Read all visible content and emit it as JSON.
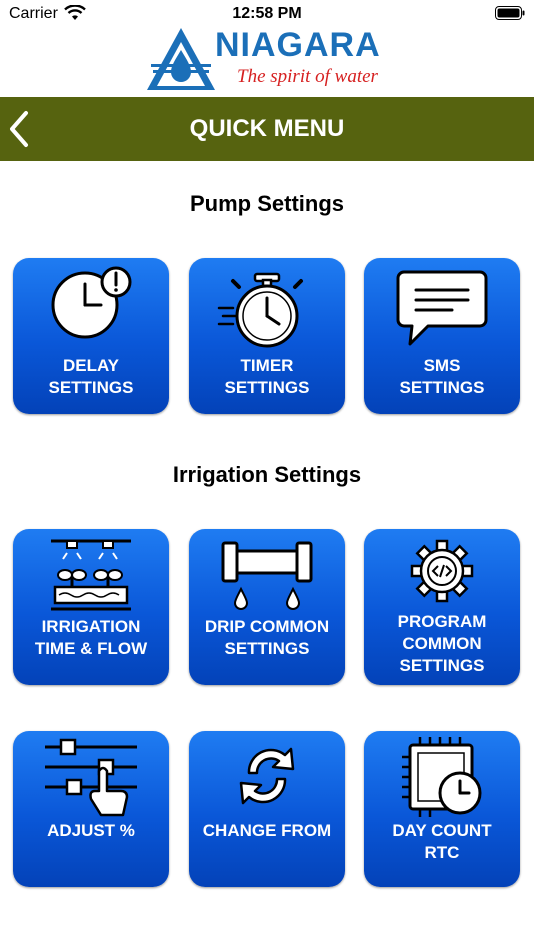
{
  "status": {
    "carrier": "Carrier",
    "time": "12:58 PM"
  },
  "brand": {
    "name": "NIAGARA",
    "tagline": "The spirit of water"
  },
  "header": {
    "title": "QUICK MENU"
  },
  "sections": {
    "pump": "Pump Settings",
    "irrigation": "Irrigation Settings"
  },
  "tiles": {
    "delay": "DELAY\nSETTINGS",
    "timer": "TIMER\nSETTINGS",
    "sms": "SMS\nSETTINGS",
    "irrigation": "IRRIGATION\nTIME & FLOW",
    "drip": "DRIP COMMON\nSETTINGS",
    "program": "PROGRAM\nCOMMON\nSETTINGS",
    "adjust": "ADJUST %",
    "change": "CHANGE FROM",
    "daycount": "DAY COUNT\nRTC"
  },
  "colors": {
    "header_bg": "#56630f",
    "tile_top": "#1f7cf2",
    "tile_bottom": "#0342b8",
    "brand_blue": "#1b6fb8",
    "brand_red": "#d62020"
  }
}
